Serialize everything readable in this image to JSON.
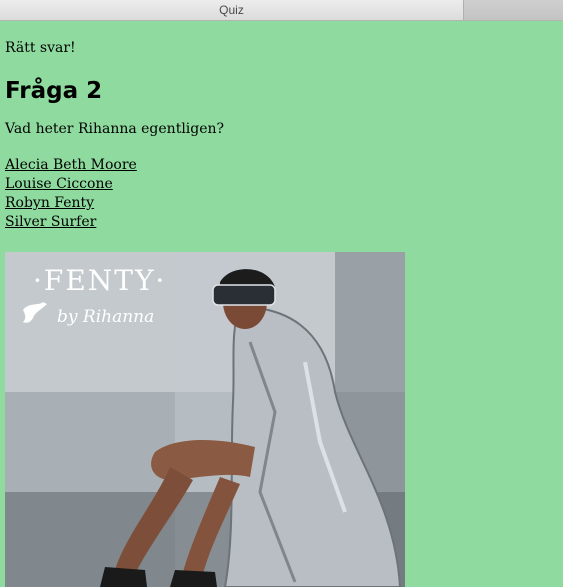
{
  "window": {
    "title": "Quiz"
  },
  "feedback": "Rätt svar!",
  "question": {
    "title": "Fråga 2",
    "text": "Vad heter Rihanna egentligen?",
    "answers": [
      "Alecia Beth Moore",
      "Louise Ciccone",
      "Robyn Fenty",
      "Silver Surfer"
    ]
  },
  "image": {
    "brand": "·FENTY·",
    "byline": "by Rihanna"
  },
  "colors": {
    "background": "#8fdb9f",
    "text": "#000000"
  }
}
